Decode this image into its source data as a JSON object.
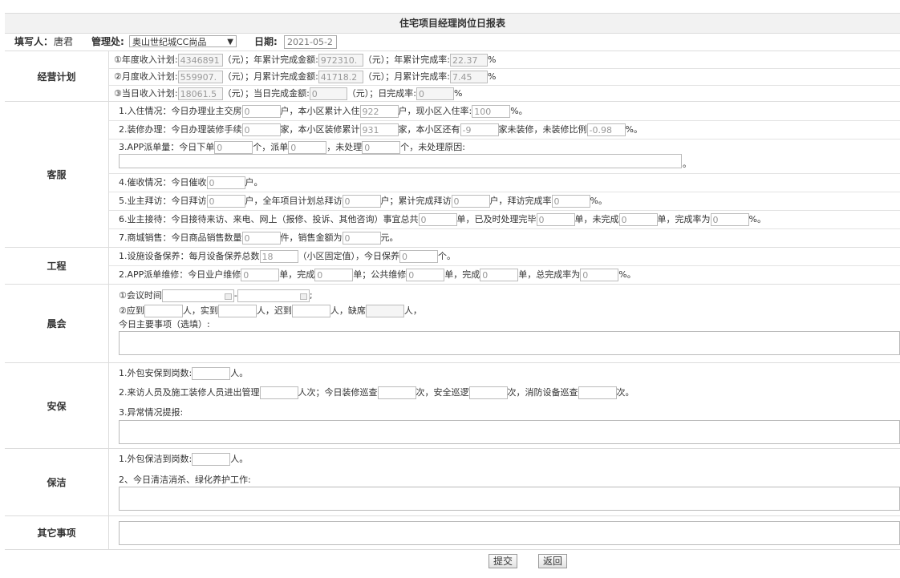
{
  "title": "住宅项目经理岗位日报表",
  "header": {
    "filler_label": "填写人：",
    "filler": "唐君",
    "office_label": "管理处:",
    "office_value": "奥山世纪城CC尚品",
    "date_label": "日期:",
    "date_value": "2021-05-2"
  },
  "business": {
    "label": "经营计划",
    "year_plan": "①年度收入计划:",
    "year_plan_val": "4346891",
    "yuan": "（元）；",
    "year_done": "年累计完成金额:",
    "year_done_val": "972310.",
    "yuan2": "（元）；",
    "year_rate": "年累计完成率:",
    "year_rate_val": "22.37",
    "pct": "%",
    "month_plan": "②月度收入计划:",
    "month_plan_val": "559907.",
    "month_done": "月累计完成金额:",
    "month_done_val": "41718.2",
    "month_rate": "月累计完成率:",
    "month_rate_val": "7.45",
    "day_plan": "③当日收入计划:",
    "day_plan_val": "18061.5",
    "day_done": "当日完成金额:",
    "day_done_val": "0",
    "day_yuan": "（元）；日完成率:",
    "day_rate_val": "0"
  },
  "service": {
    "label": "客服",
    "r1a": "1.入住情况：今日办理业主交房",
    "r1v1": "0",
    "r1b": "户，本小区累计入住",
    "r1v2": "922",
    "r1c": "户，现小区入住率:",
    "r1v3": "100",
    "r1d": "%。",
    "r2a": "2.装修办理：今日办理装修手续",
    "r2v1": "0",
    "r2b": "家，本小区装修累计",
    "r2v2": "931",
    "r2c": "家，本小区还有",
    "r2v3": "-9",
    "r2d": "家未装修，未装修比例",
    "r2v4": "-0.98",
    "r2e": "%。",
    "r3a": "3.APP派单量：今日下单",
    "r3v1": "0",
    "r3b": "个，派单",
    "r3v2": "0",
    "r3c": "，未处理",
    "r3v3": "0",
    "r3d": "个，未处理原因:",
    "r3end": "。",
    "r4a": "4.催收情况：今日催收",
    "r4v1": "0",
    "r4b": "户。",
    "r5a": "5.业主拜访：今日拜访",
    "r5v1": "0",
    "r5b": "户，全年项目计划总拜访",
    "r5v2": "0",
    "r5c": "户；累计完成拜访",
    "r5v3": "0",
    "r5d": "户，拜访完成率",
    "r5v4": "0",
    "r5e": "%。",
    "r6a": "6.业主接待：今日接待来访、来电、网上（报修、投诉、其他咨询）事宜总共",
    "r6v1": "0",
    "r6b": "单，已及时处理完毕",
    "r6v2": "0",
    "r6c": "单，未完成",
    "r6v3": "0",
    "r6d": "单，完成率为",
    "r6v4": "0",
    "r6e": "%。",
    "r7a": "7.商城销售：今日商品销售数量",
    "r7v1": "0",
    "r7b": "件，销售金额为",
    "r7v2": "0",
    "r7c": "元。"
  },
  "engineering": {
    "label": "工程",
    "r1a": "1.设施设备保养：每月设备保养总数",
    "r1v1": "18",
    "r1b": "（小区固定值），今日保养",
    "r1v2": "0",
    "r1c": "个。",
    "r2a": "2.APP派单维修：今日业户维修",
    "r2v1": "0",
    "r2b": "单，完成",
    "r2v2": "0",
    "r2c": "单；公共维修",
    "r2v3": "0",
    "r2d": "单，完成",
    "r2v4": "0",
    "r2e": "单，总完成率为",
    "r2v5": "0",
    "r2f": "%。"
  },
  "meeting": {
    "label": "晨会",
    "time": "①会议时间",
    "dash": "-",
    "semi": ";",
    "should": "②应到",
    "people": "人，实到",
    "people2": "人，迟到",
    "people3": "人，缺席",
    "people4": "人，",
    "matters": "今日主要事项（选填）:"
  },
  "security": {
    "label": "安保",
    "r1": "1.外包安保到岗数:",
    "r1b": "人。",
    "r2a": "2.来访人员及施工装修人员进出管理",
    "r2b": "人次；今日装修巡查",
    "r2c": "次，安全巡逻",
    "r2d": "次，消防设备巡查",
    "r2e": "次。",
    "r3": "3.异常情况提报:"
  },
  "cleaning": {
    "label": "保洁",
    "r1": "1.外包保洁到岗数:",
    "r1b": "人。",
    "r2": "2、今日清洁消杀、绿化养护工作:"
  },
  "other": {
    "label": "其它事项"
  },
  "buttons": {
    "submit": "提交",
    "back": "返回"
  }
}
